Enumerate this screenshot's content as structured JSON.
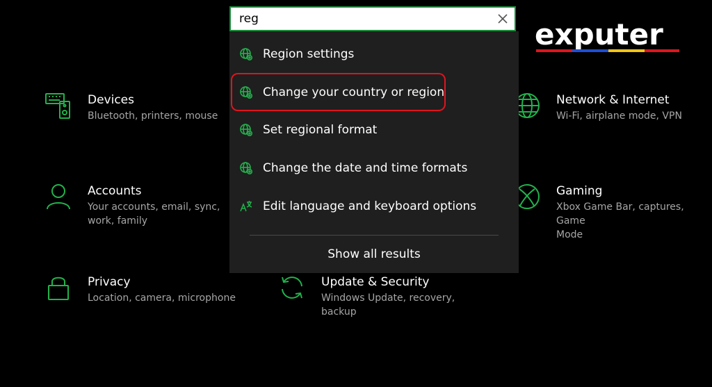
{
  "search": {
    "value": "reg",
    "clear_icon": "close-icon"
  },
  "results": [
    {
      "label": "Region settings",
      "icon": "globe-settings-icon"
    },
    {
      "label": "Change your country or region",
      "icon": "globe-settings-icon"
    },
    {
      "label": "Set regional format",
      "icon": "globe-settings-icon"
    },
    {
      "label": "Change the date and time formats",
      "icon": "globe-settings-icon"
    },
    {
      "label": "Edit language and keyboard options",
      "icon": "language-icon"
    }
  ],
  "show_all": "Show all results",
  "tiles": {
    "devices": {
      "title": "Devices",
      "subtitle": "Bluetooth, printers, mouse",
      "icon": "devices-icon"
    },
    "network": {
      "title": "Network & Internet",
      "subtitle": "Wi-Fi, airplane mode, VPN",
      "icon": "globe-icon"
    },
    "accounts": {
      "title": "Accounts",
      "subtitle_1": "Your accounts, email, sync,",
      "subtitle_2": "work, family",
      "icon": "person-icon"
    },
    "gaming": {
      "title": "Gaming",
      "subtitle_1": "Xbox Game Bar, captures, Game",
      "subtitle_2": "Mode",
      "icon": "xbox-icon"
    },
    "privacy": {
      "title": "Privacy",
      "subtitle": "Location, camera, microphone",
      "icon": "lock-icon"
    },
    "update": {
      "title": "Update & Security",
      "subtitle_1": "Windows Update, recovery,",
      "subtitle_2": "backup",
      "icon": "sync-icon"
    }
  },
  "watermark": {
    "text": "exputer"
  },
  "colors": {
    "accent": "#1c8c3c",
    "icon_green": "#22b24c",
    "highlight": "#e0141e",
    "panel": "#1f1f1f",
    "background": "#000000"
  }
}
